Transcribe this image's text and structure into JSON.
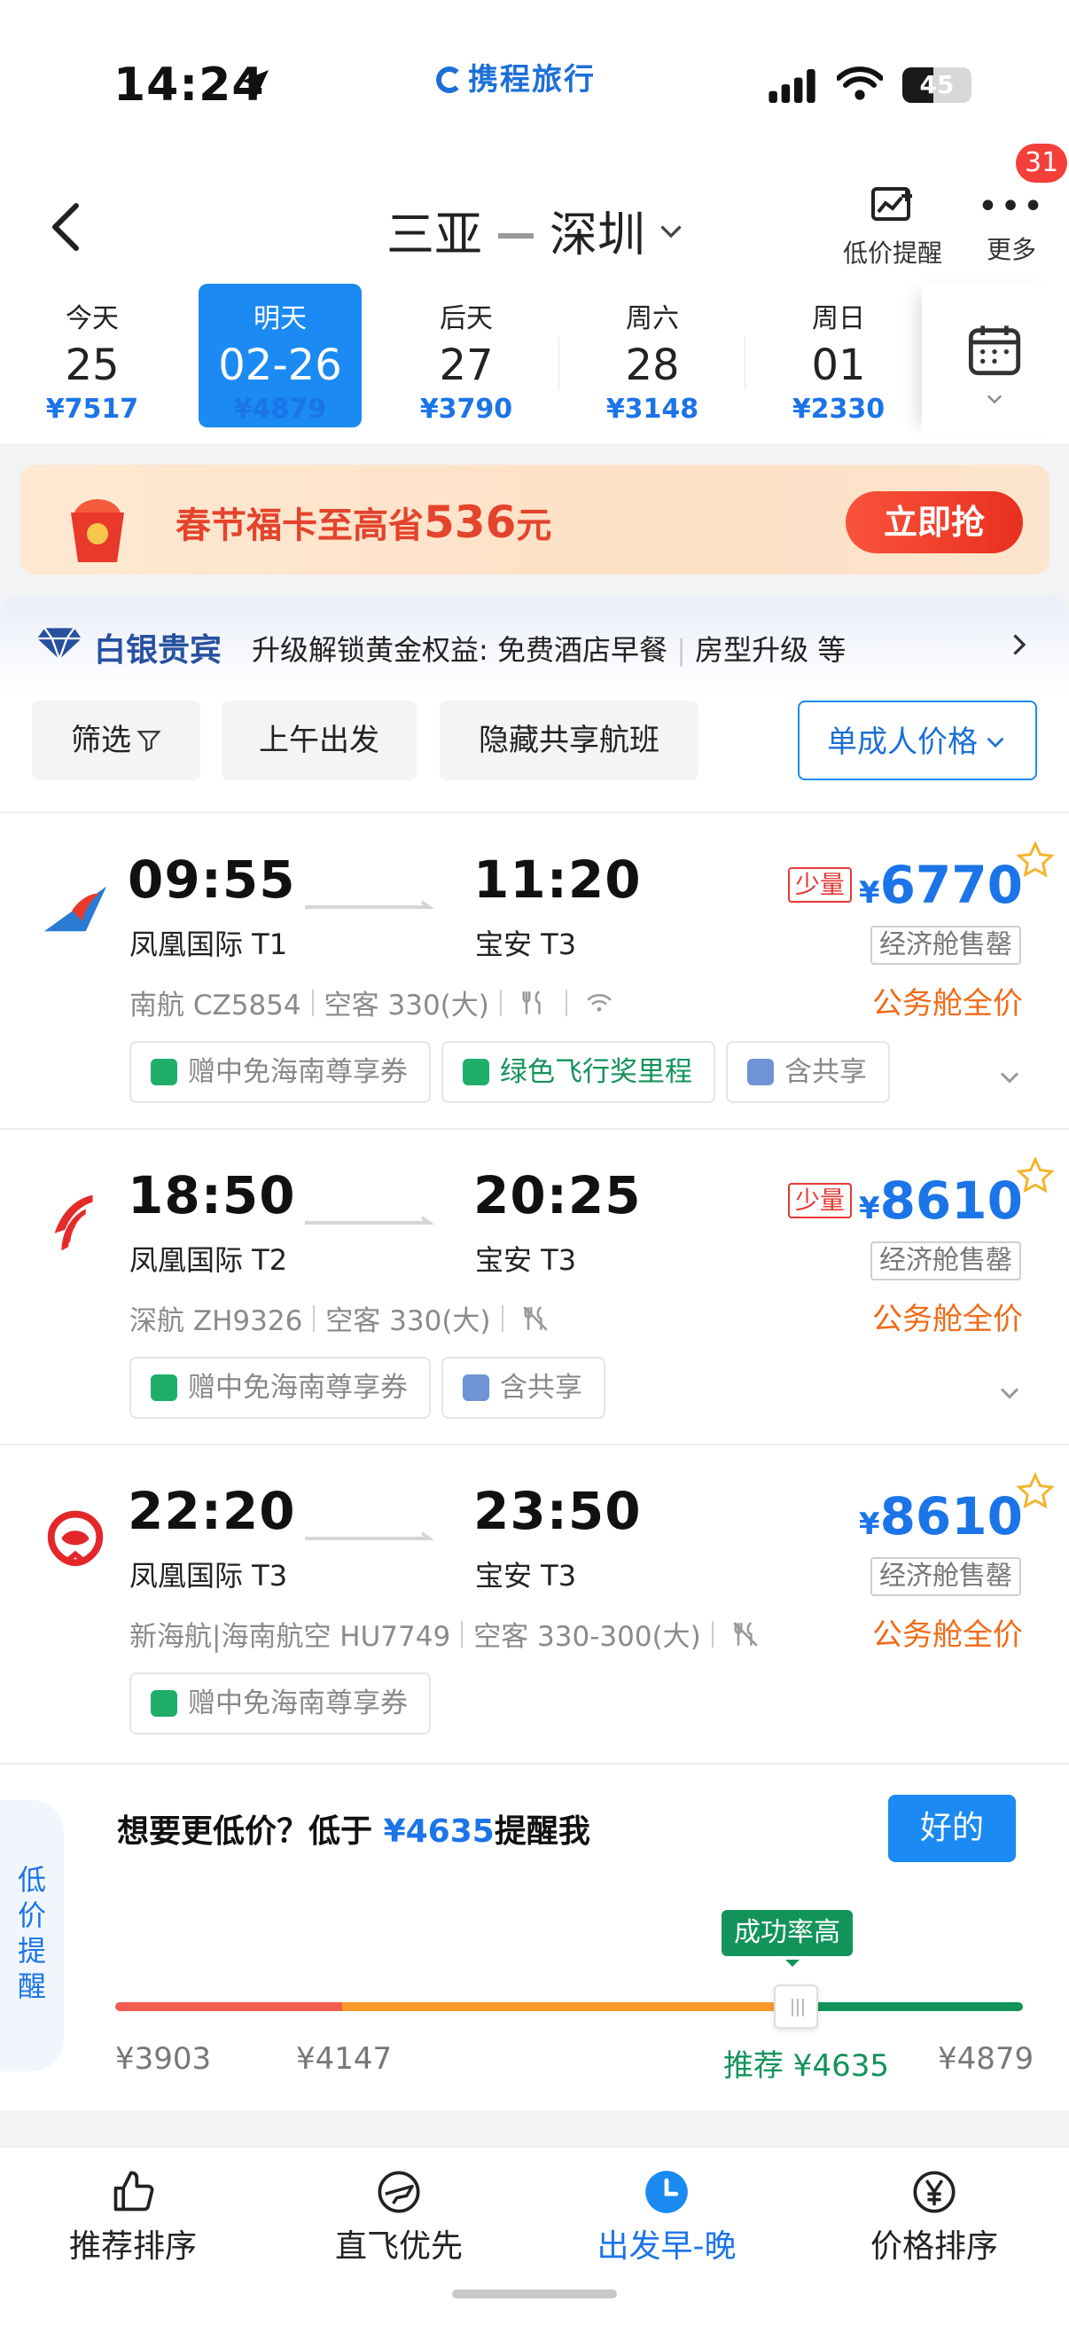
{
  "status_bar": {
    "time": "14:24",
    "brand": "携程旅行",
    "battery": "45",
    "battery_level": 0.45
  },
  "header": {
    "origin": "三亚",
    "destination": "深圳",
    "price_alert_label": "低价提醒",
    "more_label": "更多",
    "notification_count": "31"
  },
  "dates": [
    {
      "day": "今天",
      "date": "25",
      "price": "¥7517"
    },
    {
      "day": "明天",
      "date": "02-26",
      "price": "¥4879"
    },
    {
      "day": "后天",
      "date": "27",
      "price": "¥3790"
    },
    {
      "day": "周六",
      "date": "28",
      "price": "¥3148"
    },
    {
      "day": "周日",
      "date": "01",
      "price": "¥2330"
    }
  ],
  "promo": {
    "text": "春节福卡至高省",
    "amount": "536",
    "unit": "元",
    "button": "立即抢"
  },
  "member": {
    "level": "白银贵宾",
    "desc": "升级解锁黄金权益: 免费酒店早餐",
    "extra": "房型升级 等"
  },
  "filters": {
    "filter": "筛选",
    "morning": "上午出发",
    "hide_shared": "隐藏共享航班",
    "price_mode": "单成人价格"
  },
  "flights": [
    {
      "dep_time": "09:55",
      "dep_airport": "凤凰国际 T1",
      "arr_time": "11:20",
      "arr_airport": "宝安 T3",
      "airline": "南航 CZ5854",
      "aircraft": "空客 330(大)",
      "limited": "少量",
      "currency": "¥",
      "price": "6770",
      "cabin": "经济舱售罄",
      "full_price": "公务舱全价",
      "tags": [
        "赠中免海南尊享券",
        "绿色飞行奖里程",
        "含共享"
      ]
    },
    {
      "dep_time": "18:50",
      "dep_airport": "凤凰国际 T2",
      "arr_time": "20:25",
      "arr_airport": "宝安 T3",
      "airline": "深航 ZH9326",
      "aircraft": "空客 330(大)",
      "limited": "少量",
      "currency": "¥",
      "price": "8610",
      "cabin": "经济舱售罄",
      "full_price": "公务舱全价",
      "tags": [
        "赠中免海南尊享券",
        "含共享"
      ]
    },
    {
      "dep_time": "22:20",
      "dep_airport": "凤凰国际 T3",
      "arr_time": "23:50",
      "arr_airport": "宝安 T3",
      "airline": "新海航|海南航空 HU7749",
      "aircraft": "空客 330-300(大)",
      "currency": "¥",
      "price": "8610",
      "cabin": "经济舱售罄",
      "full_price": "公务舱全价",
      "tags": [
        "赠中免海南尊享券"
      ]
    }
  ],
  "price_alert": {
    "side_tab": "低价提醒",
    "question_prefix": "想要更低价？低于",
    "target": "¥4635",
    "question_suffix": "提醒我",
    "ok": "好的",
    "success_tip": "成功率高",
    "ticks": [
      "¥3903",
      "¥4147",
      "推荐 ¥4635",
      "¥4879"
    ],
    "range": [
      3903,
      4879
    ],
    "handle_value": 4635,
    "colors": {
      "low": "#f25b4f",
      "mid": "#f79a2a",
      "high": "#12935a"
    }
  },
  "bottom_nav": [
    {
      "label": "推荐排序",
      "icon": "thumbs-up-icon"
    },
    {
      "label": "直飞优先",
      "icon": "plane-circle-icon"
    },
    {
      "label": "出发早-晚",
      "icon": "clock-icon"
    },
    {
      "label": "价格排序",
      "icon": "yen-circle-icon"
    }
  ]
}
